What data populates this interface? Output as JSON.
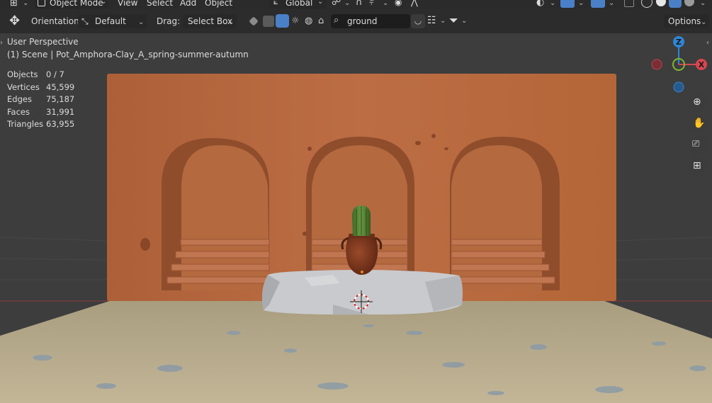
{
  "menu": {
    "mode_label": "Object Mode",
    "view": "View",
    "select": "Select",
    "add": "Add",
    "object": "Object",
    "transform_orientation": "Global"
  },
  "toolbar": {
    "orientation_label": "Orientation:",
    "orientation_value": "Default",
    "drag_label": "Drag:",
    "drag_value": "Select Box",
    "search_value": "ground",
    "options_label": "Options"
  },
  "overlay": {
    "perspective": "User Perspective",
    "scene": "(1) Scene | Pot_Amphora-Clay_A_spring-summer-autumn"
  },
  "stats": [
    {
      "label": "Objects",
      "value": "0 / 7"
    },
    {
      "label": "Vertices",
      "value": "45,599"
    },
    {
      "label": "Edges",
      "value": "75,187"
    },
    {
      "label": "Faces",
      "value": "31,991"
    },
    {
      "label": "Triangles",
      "value": "63,955"
    }
  ],
  "gizmo": {
    "z": "Z",
    "x": "X"
  },
  "colors": {
    "header_bg": "#282828",
    "wall": "#b96a42",
    "floor": "#b5a78a",
    "stone": "#c9cacc",
    "axis_x": "#d8464f",
    "axis_y": "#7ab92f",
    "axis_z": "#2f86d6",
    "accent": "#4a80c8"
  }
}
